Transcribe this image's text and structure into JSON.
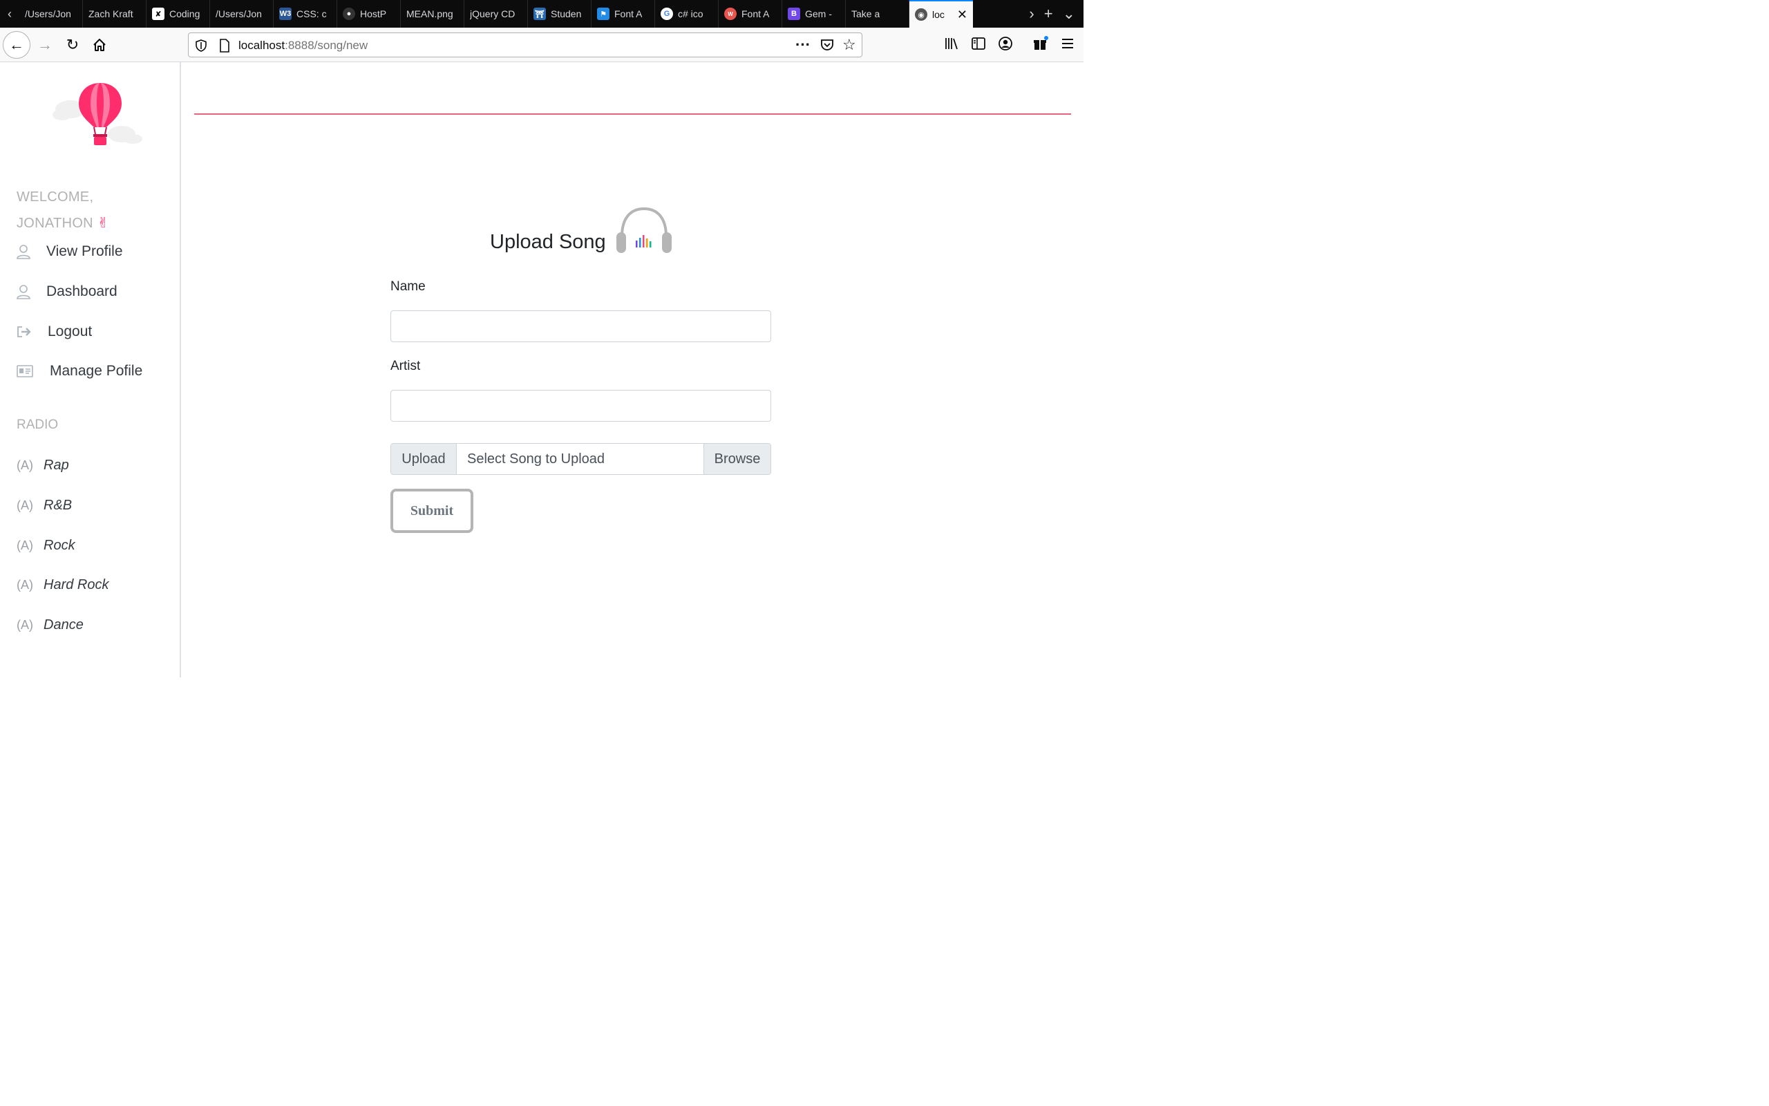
{
  "browser": {
    "tabs": [
      {
        "title": "/Users/Jon",
        "fav_color": "#0c0c0d",
        "fav_glyph": ""
      },
      {
        "title": "Zach Kraft",
        "fav_color": "#0c0c0d",
        "fav_glyph": ""
      },
      {
        "title": "Coding",
        "fav_color": "#ffffff",
        "fav_glyph": "✘"
      },
      {
        "title": "/Users/Jon",
        "fav_color": "#0c0c0d",
        "fav_glyph": ""
      },
      {
        "title": "CSS: c",
        "fav_color": "#2b5797",
        "fav_glyph": "W3"
      },
      {
        "title": "HostP",
        "fav_color": "#333333",
        "fav_glyph": "●"
      },
      {
        "title": "MEAN.png",
        "fav_color": "#0c0c0d",
        "fav_glyph": ""
      },
      {
        "title": "jQuery CD",
        "fav_color": "#0c0c0d",
        "fav_glyph": ""
      },
      {
        "title": "Studen",
        "fav_color": "#2b6cb0",
        "fav_glyph": "⛩"
      },
      {
        "title": "Font A",
        "fav_color": "#228be6",
        "fav_glyph": "⚑"
      },
      {
        "title": "c# ico",
        "fav_color": "#ffffff",
        "fav_glyph": "G"
      },
      {
        "title": "Font A",
        "fav_color": "#e8554e",
        "fav_glyph": "W"
      },
      {
        "title": "Gem -",
        "fav_color": "#7048e8",
        "fav_glyph": "B"
      },
      {
        "title": "Take a",
        "fav_color": "#0c0c0d",
        "fav_glyph": ""
      },
      {
        "title": "loc",
        "fav_color": "#555555",
        "fav_glyph": "◉"
      }
    ],
    "url_host": "localhost",
    "url_rest": ":8888/song/new"
  },
  "sidebar": {
    "welcome_line1": "WELCOME,",
    "welcome_line2": "JONATHON",
    "welcome_emoji": "✌",
    "menu": [
      {
        "label": "View Profile"
      },
      {
        "label": "Dashboard"
      },
      {
        "label": "Logout"
      },
      {
        "label": "Manage Pofile"
      }
    ],
    "radio_heading": "RADIO",
    "radio": [
      {
        "label": "Rap"
      },
      {
        "label": "R&B"
      },
      {
        "label": "Rock"
      },
      {
        "label": "Hard Rock"
      },
      {
        "label": "Dance"
      }
    ]
  },
  "form": {
    "title": "Upload Song",
    "name_label": "Name",
    "name_value": "",
    "artist_label": "Artist",
    "artist_value": "",
    "upload_prepend": "Upload",
    "file_placeholder": "Select Song to Upload",
    "browse_label": "Browse",
    "submit_label": "Submit"
  },
  "colors": {
    "accent": "#e8647e",
    "balloon": "#ff2d6b"
  }
}
